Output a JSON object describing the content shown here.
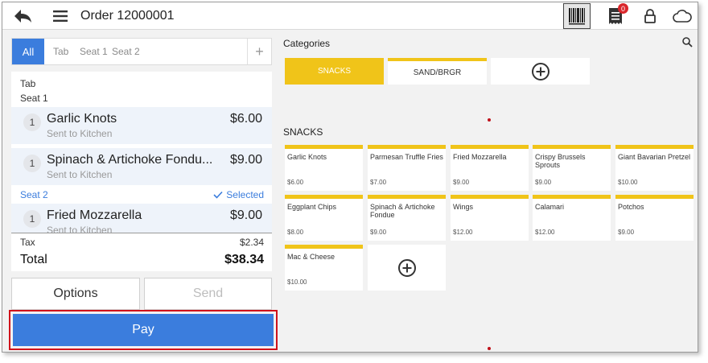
{
  "header": {
    "order_title": "Order 12000001",
    "notification_count": "0",
    "icons": [
      "back-arrow-icon",
      "menu-icon",
      "barcode-icon",
      "ticket-icon",
      "lock-icon",
      "cloud-icon"
    ]
  },
  "tabs": {
    "all": "All",
    "tab": "Tab",
    "seat1": "Seat 1",
    "seat2": "Seat 2",
    "add": "+"
  },
  "ticket": {
    "tab_label": "Tab",
    "seat1_label": "Seat 1",
    "seat2_label": "Seat 2",
    "selected_label": "Selected",
    "items": [
      {
        "qty": "1",
        "name": "Garlic Knots",
        "status": "Sent to Kitchen",
        "price": "$6.00"
      },
      {
        "qty": "1",
        "name": "Spinach & Artichoke Fondu...",
        "status": "Sent to Kitchen",
        "price": "$9.00"
      },
      {
        "qty": "1",
        "name": "Fried Mozzarella",
        "status": "Sent to Kitchen",
        "price": "$9.00"
      }
    ]
  },
  "totals": {
    "tax_label": "Tax",
    "tax_value": "$2.34",
    "total_label": "Total",
    "total_value": "$38.34"
  },
  "actions": {
    "options": "Options",
    "send": "Send",
    "pay": "Pay"
  },
  "categories": {
    "heading": "Categories",
    "items": [
      "SNACKS",
      "SAND/BRGR"
    ],
    "selected": "SNACKS"
  },
  "snacks": {
    "heading": "SNACKS",
    "items": [
      {
        "name": "Garlic Knots",
        "price": "$6.00"
      },
      {
        "name": "Parmesan Truffle Fries",
        "price": "$7.00"
      },
      {
        "name": "Fried Mozzarella",
        "price": "$9.00"
      },
      {
        "name": "Crispy Brussels Sprouts",
        "price": "$9.00"
      },
      {
        "name": "Giant Bavarian Pretzel",
        "price": "$10.00"
      },
      {
        "name": "Eggplant Chips",
        "price": "$8.00"
      },
      {
        "name": "Spinach & Artichoke Fondue",
        "price": "$9.00"
      },
      {
        "name": "Wings",
        "price": "$12.00"
      },
      {
        "name": "Calamari",
        "price": "$12.00"
      },
      {
        "name": "Potchos",
        "price": "$9.00"
      },
      {
        "name": "Mac & Cheese",
        "price": "$10.00"
      }
    ]
  },
  "colors": {
    "accent_blue": "#3b7ddd",
    "category_yellow": "#f0c419",
    "highlight_red": "#d0121b"
  }
}
